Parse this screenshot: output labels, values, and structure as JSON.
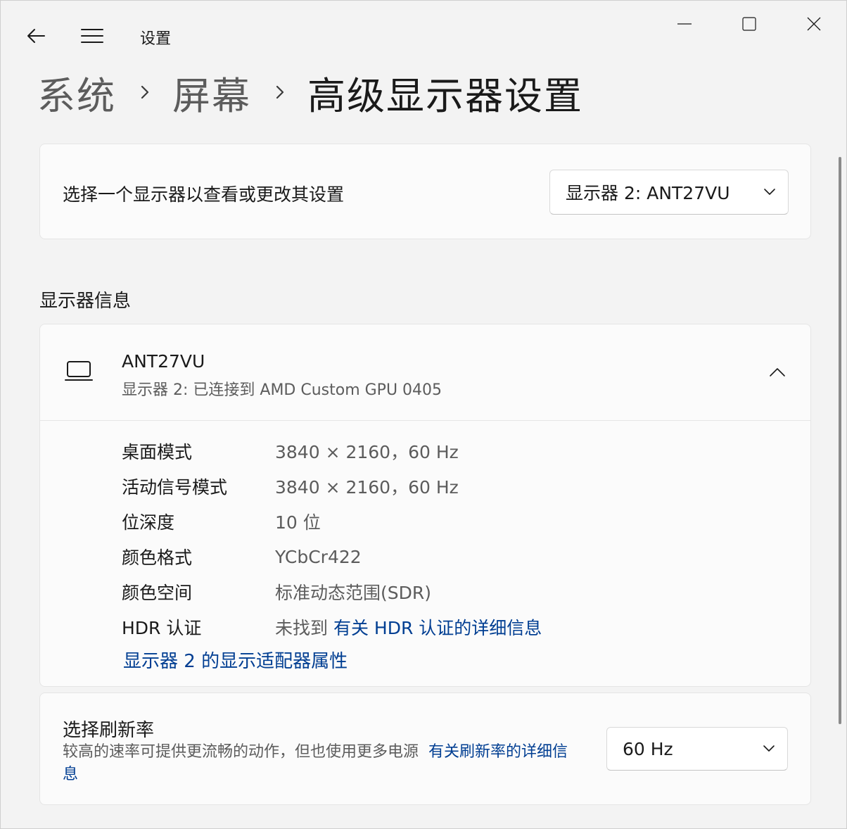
{
  "app": {
    "title": "设置"
  },
  "breadcrumb": {
    "items": [
      "系统",
      "屏幕",
      "高级显示器设置"
    ]
  },
  "monitor_select": {
    "label": "选择一个显示器以查看或更改其设置",
    "selected": "显示器 2: ANT27VU"
  },
  "display_info": {
    "section_title": "显示器信息",
    "monitor_name": "ANT27VU",
    "monitor_sub": "显示器 2: 已连接到 AMD Custom GPU 0405",
    "rows": [
      {
        "key": "桌面模式",
        "value": "3840 × 2160，60 Hz"
      },
      {
        "key": "活动信号模式",
        "value": "3840 × 2160，60 Hz"
      },
      {
        "key": "位深度",
        "value": "10 位"
      },
      {
        "key": "颜色格式",
        "value": "YCbCr422"
      },
      {
        "key": "颜色空间",
        "value": "标准动态范围(SDR)"
      }
    ],
    "hdr": {
      "key": "HDR 认证",
      "value": "未找到",
      "link": "有关 HDR 认证的详细信息"
    },
    "adapter_link": "显示器 2 的显示适配器属性"
  },
  "refresh_rate": {
    "title": "选择刷新率",
    "description": "较高的速率可提供更流畅的动作，但也使用更多电源",
    "link": "有关刷新率的详细信息",
    "selected": "60 Hz"
  },
  "icons": {
    "back": "back-arrow-icon",
    "menu": "hamburger-menu-icon",
    "minimize": "minimize-icon",
    "maximize": "maximize-icon",
    "close": "close-icon",
    "chevron_right": "chevron-right-icon",
    "chevron_down": "chevron-down-icon",
    "chevron_up": "chevron-up-icon",
    "monitor": "laptop-icon"
  },
  "colors": {
    "link": "#003e92",
    "background": "#f3f3f3",
    "card": "#fbfbfb"
  }
}
